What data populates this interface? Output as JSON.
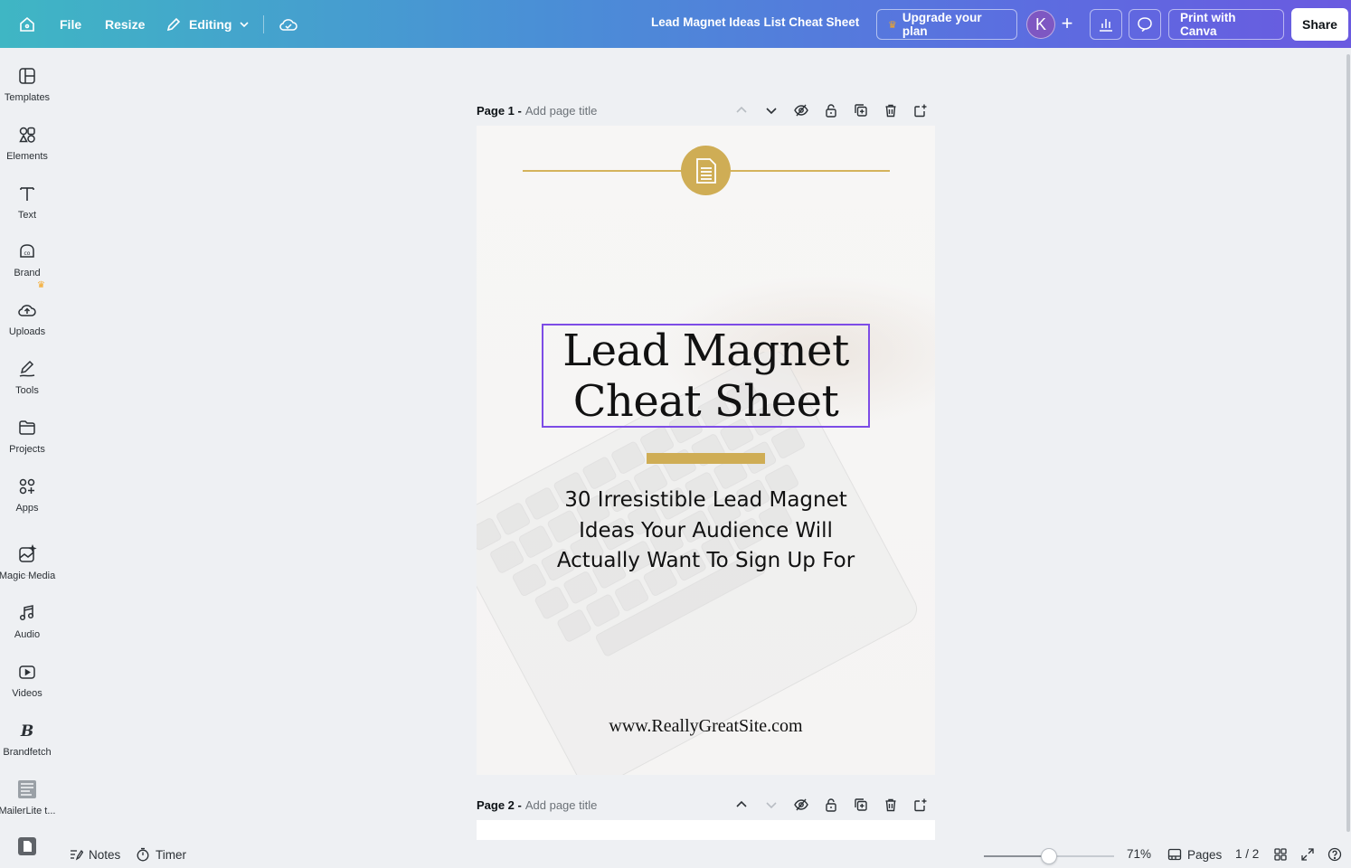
{
  "topbar": {
    "file": "File",
    "resize": "Resize",
    "editing": "Editing",
    "doc_title": "Lead Magnet Ideas List Cheat Sheet",
    "upgrade": "Upgrade your plan",
    "avatar_initial": "K",
    "print": "Print with Canva",
    "share": "Share"
  },
  "sidebar": {
    "items": [
      {
        "label": "Templates",
        "icon": "templates-icon"
      },
      {
        "label": "Elements",
        "icon": "elements-icon"
      },
      {
        "label": "Text",
        "icon": "text-icon"
      },
      {
        "label": "Brand",
        "icon": "brand-icon"
      },
      {
        "label": "Uploads",
        "icon": "uploads-icon"
      },
      {
        "label": "Tools",
        "icon": "tools-icon"
      },
      {
        "label": "Projects",
        "icon": "projects-icon"
      },
      {
        "label": "Apps",
        "icon": "apps-icon"
      },
      {
        "label": "Magic Media",
        "icon": "magic-media-icon"
      },
      {
        "label": "Audio",
        "icon": "audio-icon"
      },
      {
        "label": "Videos",
        "icon": "videos-icon"
      },
      {
        "label": "Brandfetch",
        "icon": "brandfetch-icon"
      },
      {
        "label": "MailerLite t...",
        "icon": "mailerlite-icon"
      }
    ]
  },
  "page1": {
    "name": "Page 1 -",
    "title_placeholder": "Add page title",
    "heading_line1": "Lead Magnet",
    "heading_line2": "Cheat Sheet",
    "subtitle_line1": "30 Irresistible Lead Magnet",
    "subtitle_line2": "Ideas Your Audience Will",
    "subtitle_line3": "Actually Want To Sign Up For",
    "website": "www.ReallyGreatSite.com"
  },
  "page2": {
    "name": "Page 2 -",
    "title_placeholder": "Add page title"
  },
  "bottombar": {
    "notes": "Notes",
    "timer": "Timer",
    "zoom": "71%",
    "zoom_level": 0.5,
    "pages": "Pages",
    "page_count": "1 / 2"
  },
  "colors": {
    "accent_gold": "#cfad55",
    "selection": "#7d4ce6"
  }
}
